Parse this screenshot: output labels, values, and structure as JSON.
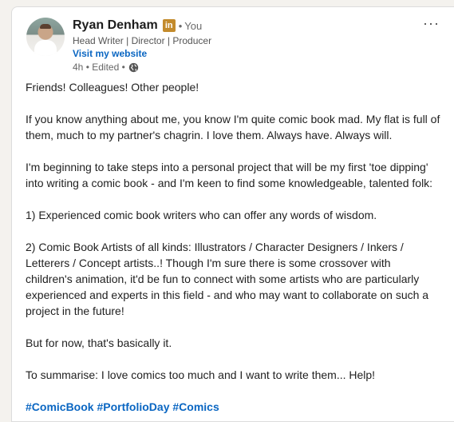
{
  "post": {
    "author": {
      "name": "Ryan Denham",
      "badge": "in",
      "relation": "You",
      "headline": "Head Writer | Director | Producer",
      "website_link": "Visit my website",
      "time": "4h",
      "edited": "Edited",
      "visibility_icon": "globe-icon"
    },
    "menu_icon": "more-icon",
    "menu_text": "···",
    "paragraphs": [
      "Friends! Colleagues! Other people!",
      "If you know anything about me, you know I'm quite comic book mad. My flat is full of them, much to my partner's chagrin. I love them. Always have. Always will.",
      "I'm beginning to take steps into a personal project that will be my first 'toe dipping' into writing a comic book - and I'm keen to find some knowledgeable, talented folk:",
      "1) Experienced comic book writers who can offer any words of wisdom.",
      "2) Comic Book Artists of all kinds: Illustrators / Character Designers / Inkers / Letterers / Concept artists..! Though I'm sure there is some crossover with children's animation, it'd be fun to connect with some artists who are particularly experienced and experts in this field - and who may want to collaborate on such a project in the future!",
      "But for now, that's basically it.",
      "To summarise: I love comics too much and I want to write them... Help!"
    ],
    "hashtags": [
      "#ComicBook",
      "#PortfolioDay",
      "#Comics"
    ]
  },
  "colors": {
    "link": "#0a66c2",
    "badge": "#c38b2c",
    "text": "#1f1f1f",
    "muted": "#666666"
  }
}
